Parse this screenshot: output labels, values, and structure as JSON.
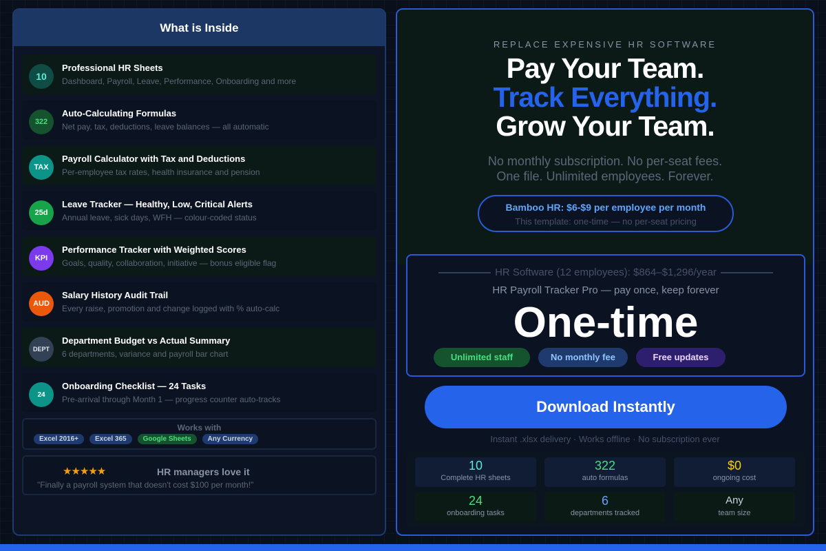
{
  "left": {
    "header": "What is Inside",
    "features": [
      {
        "badge": "10",
        "title": "Professional HR Sheets",
        "desc": "Dashboard, Payroll, Leave, Performance, Onboarding and more"
      },
      {
        "badge": "322",
        "title": "Auto-Calculating Formulas",
        "desc": "Net pay, tax, deductions, leave balances — all automatic"
      },
      {
        "badge": "TAX",
        "title": "Payroll Calculator with Tax and Deductions",
        "desc": "Per-employee tax rates, health insurance and pension"
      },
      {
        "badge": "25d",
        "title": "Leave Tracker — Healthy, Low, Critical Alerts",
        "desc": "Annual leave, sick days, WFH — colour-coded status"
      },
      {
        "badge": "KPI",
        "title": "Performance Tracker with Weighted Scores",
        "desc": "Goals, quality, collaboration, initiative — bonus eligible flag"
      },
      {
        "badge": "AUD",
        "title": "Salary History Audit Trail",
        "desc": "Every raise, promotion and change logged with % auto-calc"
      },
      {
        "badge": "DEPT",
        "title": "Department Budget vs Actual Summary",
        "desc": "6 departments, variance and payroll bar chart"
      },
      {
        "badge": "24",
        "title": "Onboarding Checklist — 24 Tasks",
        "desc": "Pre-arrival through Month 1 — progress counter auto-tracks"
      }
    ],
    "works_with": {
      "title": "Works with",
      "tags": [
        "Excel 2016+",
        "Excel 365",
        "Google Sheets",
        "Any Currency"
      ]
    },
    "love": {
      "stars": "★★★★★",
      "title": "HR managers love it",
      "quote": "\"Finally a payroll system that doesn't cost $100 per month!\""
    }
  },
  "right": {
    "eyebrow": "REPLACE EXPENSIVE HR SOFTWARE",
    "headline1": "Pay Your Team.",
    "headline2": "Track Everything.",
    "headline3": "Grow Your Team.",
    "sub1": "No monthly subscription. No per-seat fees.",
    "sub2": "One file. Unlimited employees. Forever.",
    "compare_main": "Bamboo HR: $6-$9 per employee per month",
    "compare_sub": "This template: one-time — no per-seat pricing",
    "price": {
      "strike": "HR Software (12 employees): $864–$1,296/year",
      "sub": "HR Payroll Tracker Pro — pay once, keep forever",
      "big": "One-time",
      "tags": [
        "Unlimited staff",
        "No monthly fee",
        "Free updates"
      ]
    },
    "download": "Download Instantly",
    "delivery": "Instant .xlsx delivery · Works offline · No subscription ever",
    "stats": [
      {
        "value": "10",
        "label": "Complete HR sheets"
      },
      {
        "value": "322",
        "label": "auto formulas"
      },
      {
        "value": "$0",
        "label": "ongoing cost"
      },
      {
        "value": "24",
        "label": "onboarding tasks"
      },
      {
        "value": "6",
        "label": "departments tracked"
      },
      {
        "value": "Any",
        "label": "team size"
      }
    ]
  },
  "colors": {
    "accent": "#2563eb",
    "badge_teal_dark": "#0f4c46",
    "badge_green_dark": "#14532d",
    "badge_teal": "#0d9488",
    "badge_green": "#16a34a",
    "badge_purple": "#7c3aed",
    "badge_orange": "#ea580c",
    "badge_slate": "#334155",
    "gold": "#facc15",
    "green_text": "#4ade80",
    "blue_text": "#60a5fa"
  }
}
